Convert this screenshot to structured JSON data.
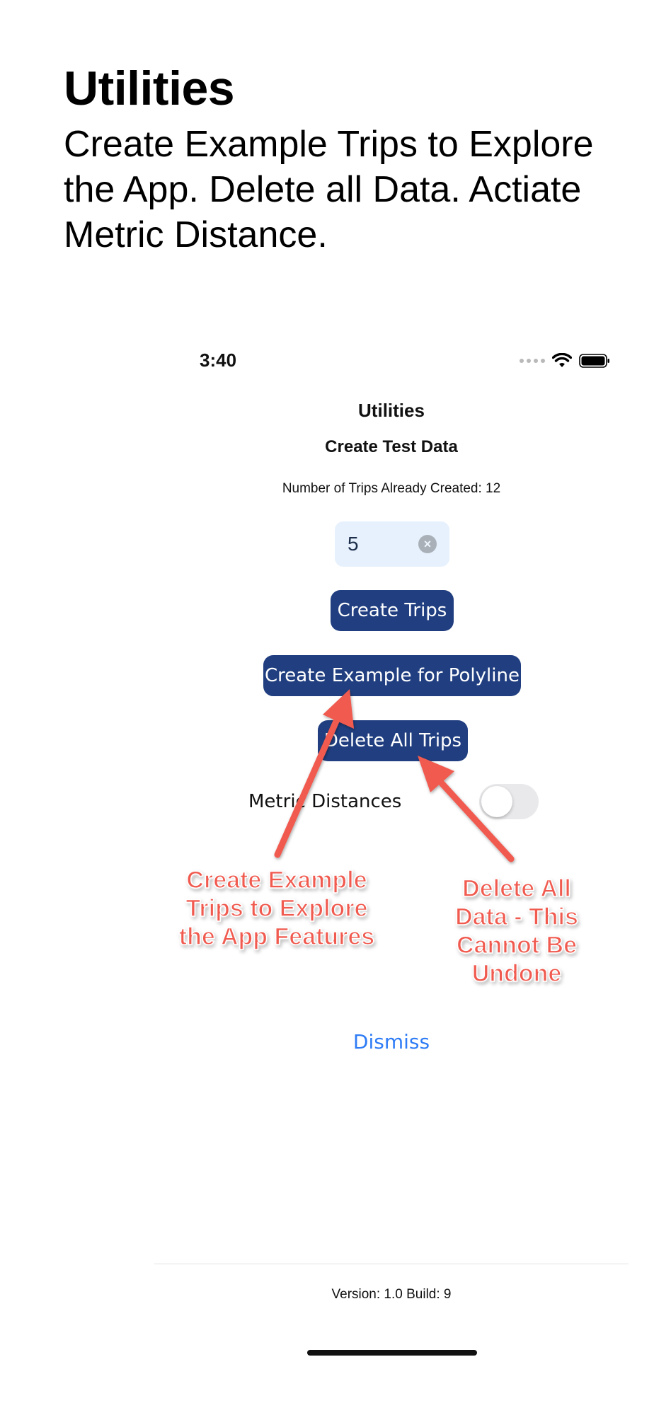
{
  "promo": {
    "title": "Utilities",
    "subtitle": "Create Example Trips to Explore the App. Delete all Data. Actiate Metric Distance."
  },
  "status_bar": {
    "time": "3:40",
    "icons": [
      "signal-icon",
      "wifi-icon",
      "battery-icon"
    ]
  },
  "nav": {
    "title": "Utilities"
  },
  "test_data": {
    "header": "Create Test Data",
    "trip_count_text": "Number of Trips Already Created: 12",
    "count_input_value": "5",
    "create_trips_label": "Create Trips",
    "create_polyline_label": "Create Example for Polyline",
    "delete_all_label": "Delete All Trips"
  },
  "settings": {
    "metric_label": "Metric Distances",
    "metric_enabled": false
  },
  "annotations": {
    "left": "Create Example Trips to Explore the App Features",
    "right": "Delete All Data - This Cannot Be Undone"
  },
  "footer": {
    "dismiss_label": "Dismiss",
    "version_text": "Version: 1.0 Build: 9"
  },
  "colors": {
    "button_bg": "#213f80",
    "link": "#2f7cf6",
    "annotation": "#f05a4f",
    "input_bg": "#e6f1fd"
  }
}
